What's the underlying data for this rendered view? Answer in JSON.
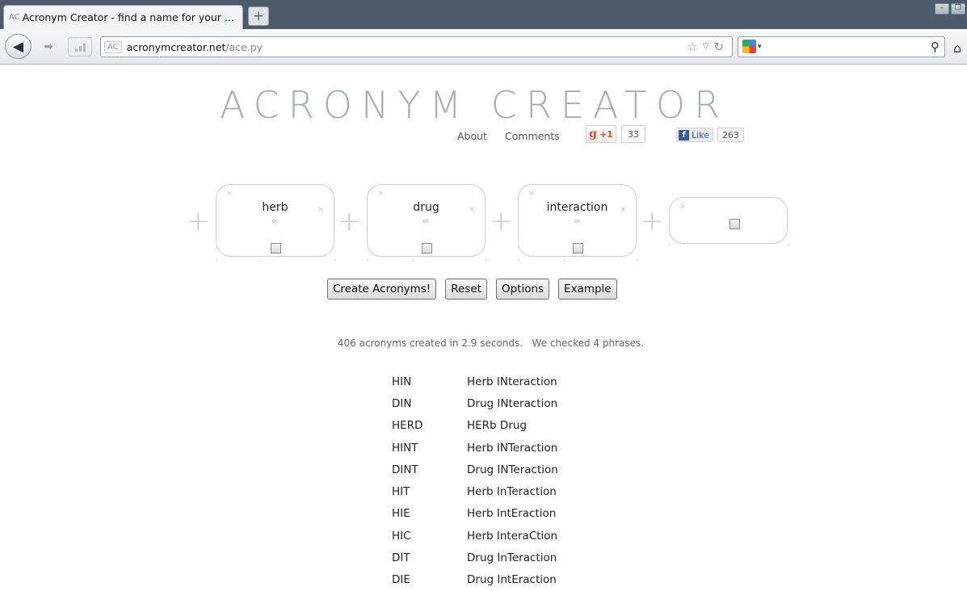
{
  "browser": {
    "tab_favicon": "AC",
    "tab_title": "Acronym Creator - find a name for your ...",
    "new_tab": "+",
    "url_badge": "AC",
    "url_host": "acronymcreator.net",
    "url_path": "/ace.py",
    "icons": [
      "back-arrow-icon",
      "forward-arrow-icon",
      "stats-icon",
      "star-icon",
      "dropdown-icon",
      "reload-icon",
      "google-icon",
      "search-icon",
      "home-icon"
    ]
  },
  "header": {
    "logo": "ACRONYM CREATOR",
    "about": "About",
    "comments": "Comments",
    "gplus_label": "+1",
    "gplus_count": "33",
    "fb_label": "Like",
    "fb_count": "263"
  },
  "words": [
    {
      "word": "herb",
      "or": "or"
    },
    {
      "word": "drug",
      "or": "or"
    },
    {
      "word": "interaction",
      "or": "or"
    },
    {
      "word": "",
      "or": ""
    }
  ],
  "buttons": {
    "create": "Create Acronyms!",
    "reset": "Reset",
    "options": "Options",
    "example": "Example"
  },
  "status": "406 acronyms created in 2.9 seconds.   We checked 4 phrases.",
  "results": [
    {
      "acronym": "HIN",
      "phrase": "Herb INteraction"
    },
    {
      "acronym": "DIN",
      "phrase": "Drug INteraction"
    },
    {
      "acronym": "HERD",
      "phrase": "HERb Drug"
    },
    {
      "acronym": "HINT",
      "phrase": "Herb INTeraction"
    },
    {
      "acronym": "DINT",
      "phrase": "Drug INTeraction"
    },
    {
      "acronym": "HIT",
      "phrase": "Herb InTeraction"
    },
    {
      "acronym": "HIE",
      "phrase": "Herb IntEraction"
    },
    {
      "acronym": "HIC",
      "phrase": "Herb InteraCtion"
    },
    {
      "acronym": "DIT",
      "phrase": "Drug InTeraction"
    },
    {
      "acronym": "DIE",
      "phrase": "Drug IntEraction"
    }
  ]
}
